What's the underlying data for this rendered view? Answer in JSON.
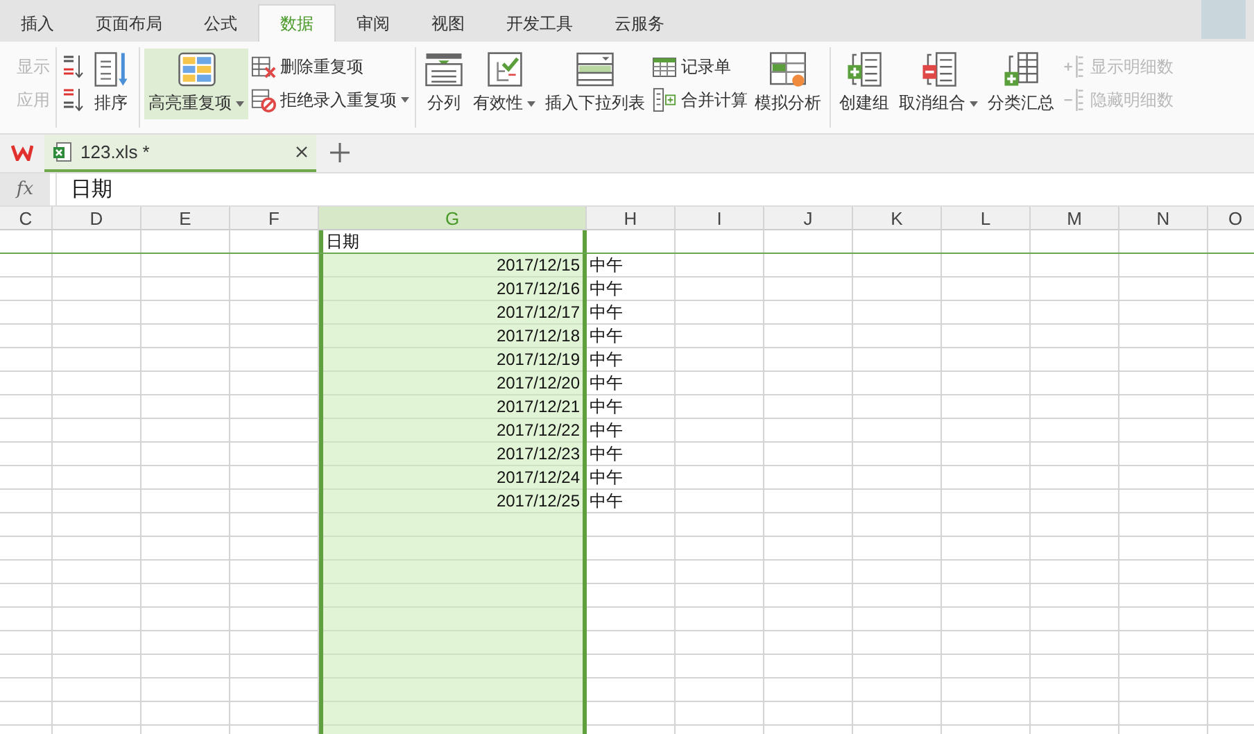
{
  "menu_tabs": [
    {
      "label": "插入",
      "selected": false
    },
    {
      "label": "页面布局",
      "selected": false
    },
    {
      "label": "公式",
      "selected": false
    },
    {
      "label": "数据",
      "selected": true
    },
    {
      "label": "审阅",
      "selected": false
    },
    {
      "label": "视图",
      "selected": false
    },
    {
      "label": "开发工具",
      "selected": false
    },
    {
      "label": "云服务",
      "selected": false
    }
  ],
  "ribbon": {
    "groups": [
      {
        "columns": [
          {
            "kind": "stack",
            "items": [
              {
                "kind": "text",
                "label": "显示",
                "disabled": true
              },
              {
                "kind": "text",
                "label": "应用",
                "disabled": true
              }
            ]
          }
        ]
      },
      {
        "columns": [
          {
            "kind": "stack",
            "items": [
              {
                "kind": "icon"
              },
              {
                "kind": "icon"
              }
            ]
          },
          {
            "kind": "large",
            "label": "排序",
            "selected": false,
            "disabled": false
          }
        ]
      },
      {
        "columns": [
          {
            "kind": "large",
            "label": "高亮重复项",
            "dropdown": true,
            "selected": true,
            "disabled": false
          },
          {
            "kind": "stack",
            "items": [
              {
                "kind": "icon_text",
                "label": "删除重复项",
                "disabled": false
              },
              {
                "kind": "icon_text",
                "label": "拒绝录入重复项",
                "dropdown": true,
                "disabled": false
              }
            ]
          }
        ]
      },
      {
        "columns": [
          {
            "kind": "large",
            "label": "分列",
            "selected": false,
            "disabled": false
          },
          {
            "kind": "large",
            "label": "有效性",
            "dropdown": true,
            "selected": false,
            "disabled": false
          },
          {
            "kind": "large",
            "label": "插入下拉列表",
            "selected": false,
            "disabled": false
          },
          {
            "kind": "stack",
            "items": [
              {
                "kind": "icon_text",
                "label": "记录单",
                "disabled": false
              },
              {
                "kind": "icon_text",
                "label": "合并计算",
                "disabled": false
              }
            ]
          },
          {
            "kind": "large",
            "label": "模拟分析",
            "selected": false,
            "disabled": false
          }
        ]
      },
      {
        "columns": [
          {
            "kind": "large",
            "label": "创建组",
            "selected": false,
            "disabled": false
          },
          {
            "kind": "large",
            "label": "取消组合",
            "dropdown": true,
            "selected": false,
            "disabled": false
          },
          {
            "kind": "large",
            "label": "分类汇总",
            "selected": false,
            "disabled": false
          },
          {
            "kind": "stack",
            "items": [
              {
                "kind": "icon_text",
                "label": "显示明细数",
                "disabled": true
              },
              {
                "kind": "icon_text",
                "label": "隐藏明细数",
                "disabled": true
              }
            ]
          }
        ]
      }
    ]
  },
  "doc_tabs": [
    {
      "label": "123.xls *",
      "selected": true
    }
  ],
  "formula_bar": {
    "label": "fx",
    "value": "日期"
  },
  "sheet": {
    "columns": [
      {
        "label": "C",
        "selected": false
      },
      {
        "label": "D",
        "selected": false
      },
      {
        "label": "E",
        "selected": false
      },
      {
        "label": "F",
        "selected": false
      },
      {
        "label": "G",
        "selected": true
      },
      {
        "label": "H",
        "selected": false
      },
      {
        "label": "I",
        "selected": false
      },
      {
        "label": "J",
        "selected": false
      },
      {
        "label": "K",
        "selected": false
      },
      {
        "label": "L",
        "selected": false
      },
      {
        "label": "M",
        "selected": false
      },
      {
        "label": "N",
        "selected": false
      },
      {
        "label": "O",
        "selected": false
      }
    ],
    "rows": [
      {
        "kind": "header",
        "column_g": "日期"
      },
      {
        "kind": "data",
        "column_g": "2017/12/15",
        "column_h": "中午"
      },
      {
        "kind": "data",
        "column_g": "2017/12/16",
        "column_h": "中午"
      },
      {
        "kind": "data",
        "column_g": "2017/12/17",
        "column_h": "中午"
      },
      {
        "kind": "data",
        "column_g": "2017/12/18",
        "column_h": "中午"
      },
      {
        "kind": "data",
        "column_g": "2017/12/19",
        "column_h": "中午"
      },
      {
        "kind": "data",
        "column_g": "2017/12/20",
        "column_h": "中午"
      },
      {
        "kind": "data",
        "column_g": "2017/12/21",
        "column_h": "中午"
      },
      {
        "kind": "data",
        "column_g": "2017/12/22",
        "column_h": "中午"
      },
      {
        "kind": "data",
        "column_g": "2017/12/23",
        "column_h": "中午"
      },
      {
        "kind": "data",
        "column_g": "2017/12/24",
        "column_h": "中午"
      },
      {
        "kind": "data",
        "column_g": "2017/12/25",
        "column_h": "中午"
      }
    ]
  }
}
